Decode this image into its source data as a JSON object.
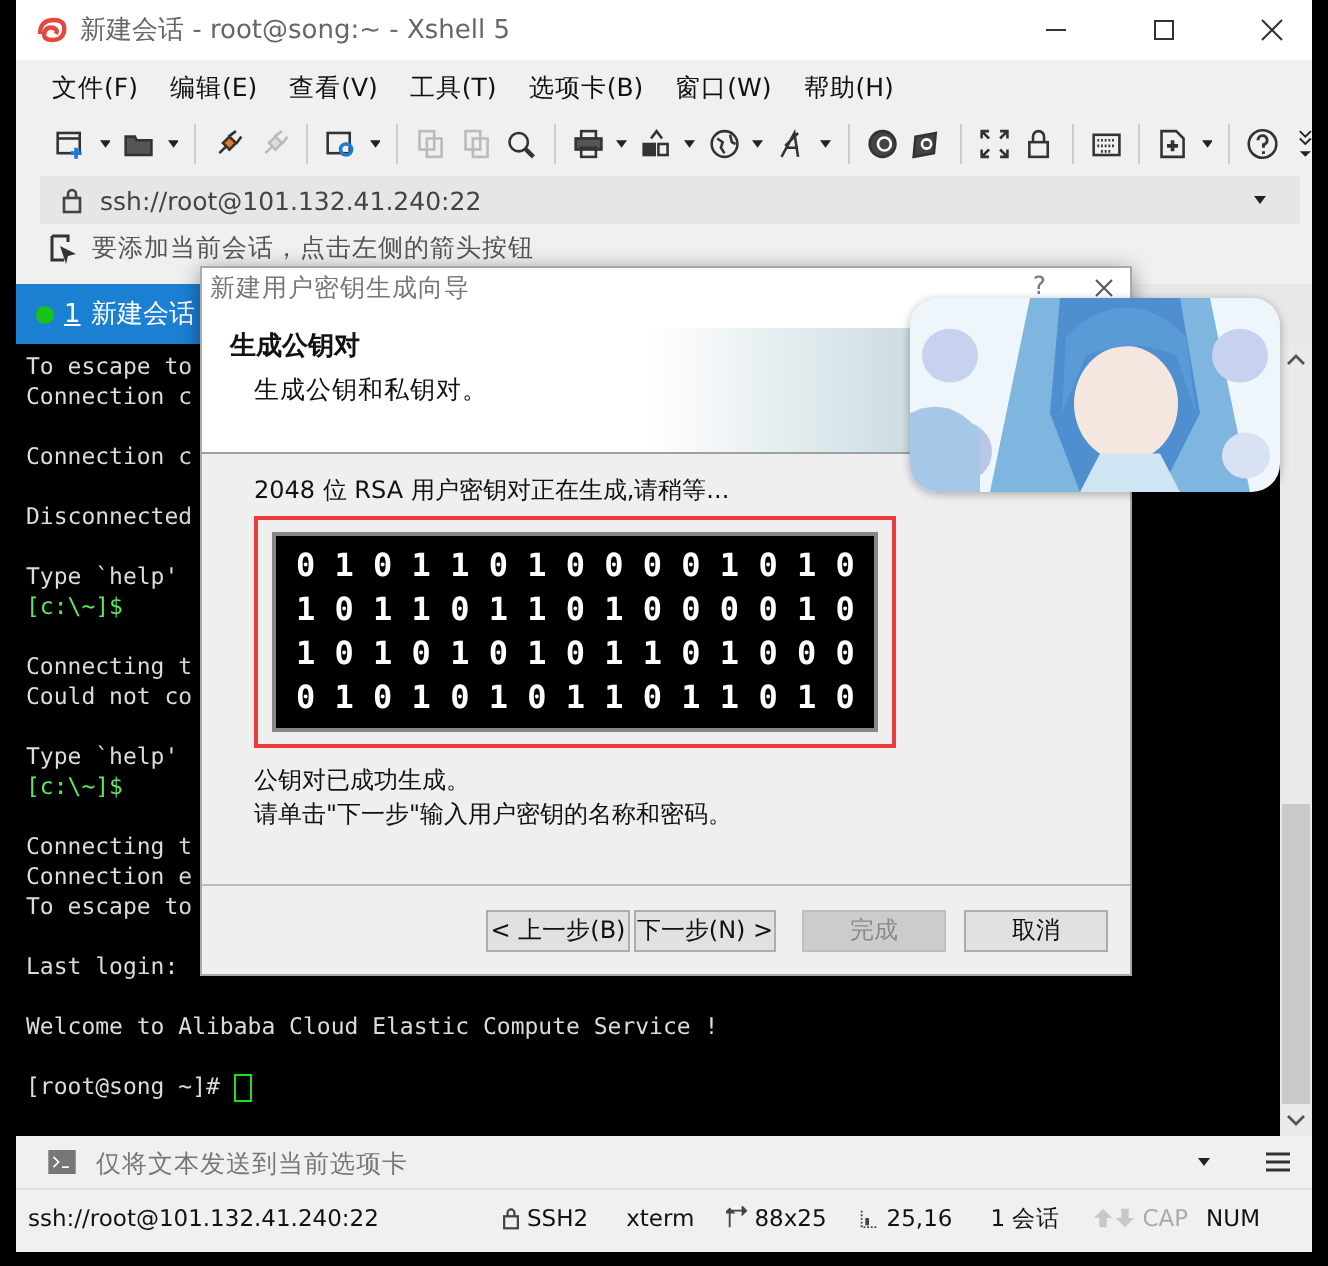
{
  "window": {
    "title": "新建会话 - root@song:~ - Xshell 5"
  },
  "menu": [
    "文件(F)",
    "编辑(E)",
    "查看(V)",
    "工具(T)",
    "选项卡(B)",
    "窗口(W)",
    "帮助(H)"
  ],
  "address_bar": {
    "value": "ssh://root@101.132.41.240:22"
  },
  "hint_bar": {
    "text": "要添加当前会话，点击左侧的箭头按钮"
  },
  "tabs": [
    {
      "number": "1",
      "label": "新建会话",
      "selected": true,
      "connected": true
    }
  ],
  "terminal": {
    "cursor": true,
    "blocks": [
      [
        {
          "text": "To escape to",
          "color": "#dcdcdc"
        },
        {
          "text": "Connection c",
          "color": "#dcdcdc"
        }
      ],
      [
        {
          "text": "Connection c",
          "color": "#dcdcdc"
        }
      ],
      [
        {
          "text": "Disconnected",
          "color": "#dcdcdc"
        }
      ],
      [
        {
          "text": "Type `help'",
          "color": "#dcdcdc"
        },
        {
          "text": "[c:\\~]$",
          "color": "#5ee65e"
        }
      ],
      [
        {
          "text": "Connecting t",
          "color": "#dcdcdc"
        },
        {
          "text": "Could not co",
          "color": "#dcdcdc"
        }
      ],
      [
        {
          "text": "Type `help'",
          "color": "#dcdcdc"
        },
        {
          "text": "[c:\\~]$",
          "color": "#5ee65e"
        }
      ],
      [
        {
          "text": "Connecting t",
          "color": "#dcdcdc"
        },
        {
          "text": "Connection e",
          "color": "#dcdcdc"
        },
        {
          "text": "To escape to",
          "color": "#dcdcdc"
        }
      ],
      [
        {
          "text": "Last login:",
          "color": "#dcdcdc"
        }
      ],
      [
        {
          "text": "Welcome to Alibaba Cloud Elastic Compute Service !",
          "color": "#dcdcdc"
        }
      ],
      [
        {
          "text": "[root@song ~]#",
          "color": "#dcdcdc"
        }
      ]
    ]
  },
  "dialog": {
    "title": "新建用户密钥生成向导",
    "help": "?",
    "heading": "生成公钥对",
    "subheading": "生成公钥和私钥对。",
    "progress_text": "2048 位 RSA 用户密钥对正在生成,请稍等...",
    "key_bits": [
      "0 1 0 1 1 0 1 0 0 0 0 1 0 1 0",
      "1 0 1 1 0 1 1 0 1 0 0 0 0 1 0",
      "1 0 1 0 1 0 1 0 1 1 0 1 0 0 0",
      "0 1 0 1 0 1 0 1 1 0 1 1 0 1 0"
    ],
    "messages": [
      "公钥对已成功生成。",
      "请单击\"下一步\"输入用户密钥的名称和密码。"
    ],
    "buttons": [
      {
        "label": "< 上一步(B)",
        "disabled": false
      },
      {
        "label": "下一步(N) >",
        "disabled": false
      },
      {
        "label": "完成",
        "disabled": true
      },
      {
        "label": "取消",
        "disabled": false
      }
    ]
  },
  "send_bar": {
    "placeholder": "仅将文本发送到当前选项卡"
  },
  "status_bar": {
    "address": "ssh://root@101.132.41.240:22",
    "protocol": "SSH2",
    "terminal": "xterm",
    "size": "88x25",
    "cursor": "25,16",
    "sessions": "1 会话",
    "caps": "CAP",
    "num": "NUM"
  }
}
